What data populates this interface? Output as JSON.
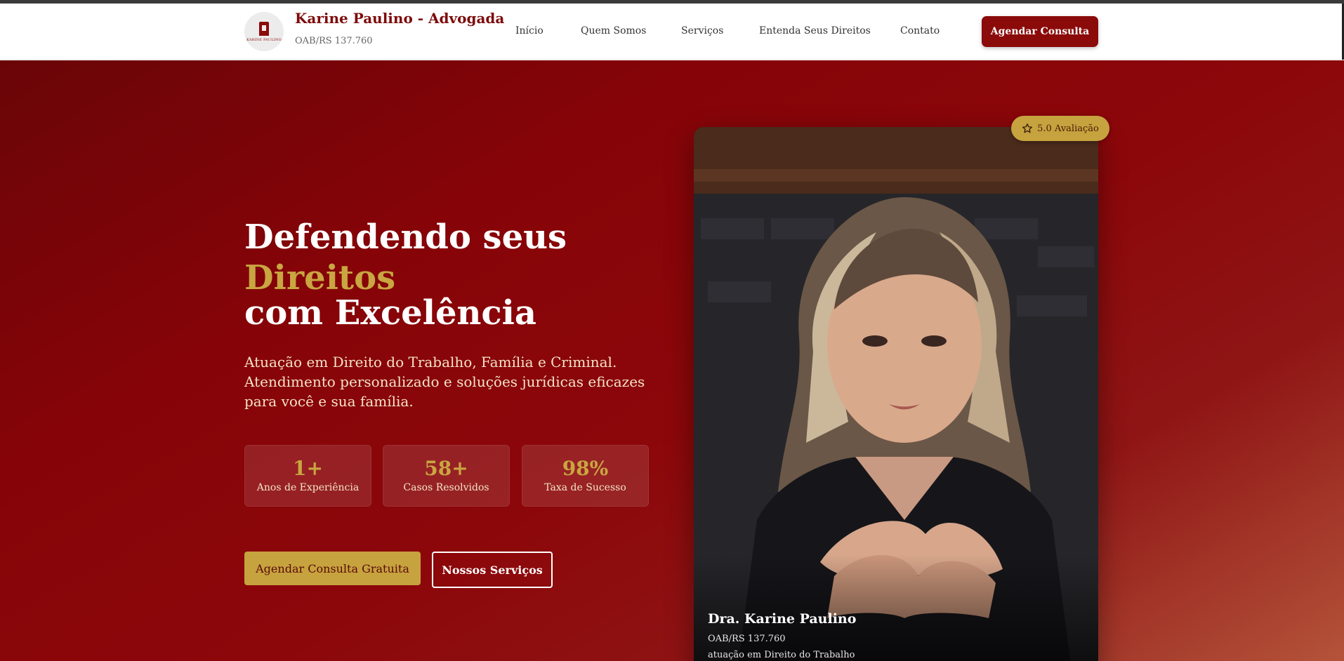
{
  "header": {
    "brand_name": "Karine Paulino - Advogada",
    "brand_oab": "OAB/RS 137.760",
    "logo_text": "KARINE PAULINO",
    "nav": [
      "Início",
      "Quem Somos",
      "Serviços",
      "Entenda Seus Direitos",
      "Contato"
    ],
    "cta": "Agendar Consulta"
  },
  "hero": {
    "title_line1": "Defendendo seus",
    "title_line2": "Direitos",
    "title_line3": "com Excelência",
    "subtitle": "Atuação em Direito do Trabalho, Família e Criminal. Atendimento personalizado e soluções jurídicas eficazes para você e sua família.",
    "stats": [
      {
        "value": "1+",
        "label": "Anos de Experiência"
      },
      {
        "value": "58+",
        "label": "Casos Resolvidos"
      },
      {
        "value": "98%",
        "label": "Taxa de Sucesso"
      }
    ],
    "primary_button": "Agendar Consulta Gratuita",
    "secondary_button": "Nossos Serviços",
    "rating_badge": "5.0 Avaliação",
    "portrait": {
      "name": "Dra. Karine Paulino",
      "oab": "OAB/RS 137.760",
      "area": "atuação em Direito do Trabalho"
    }
  },
  "colors": {
    "brand_red": "#8b0a0a",
    "gold": "#c9a641",
    "cream_text": "#f4e3c8"
  },
  "icons": {
    "rating": "star-outline-icon",
    "logo": "law-firm-logo-icon"
  }
}
